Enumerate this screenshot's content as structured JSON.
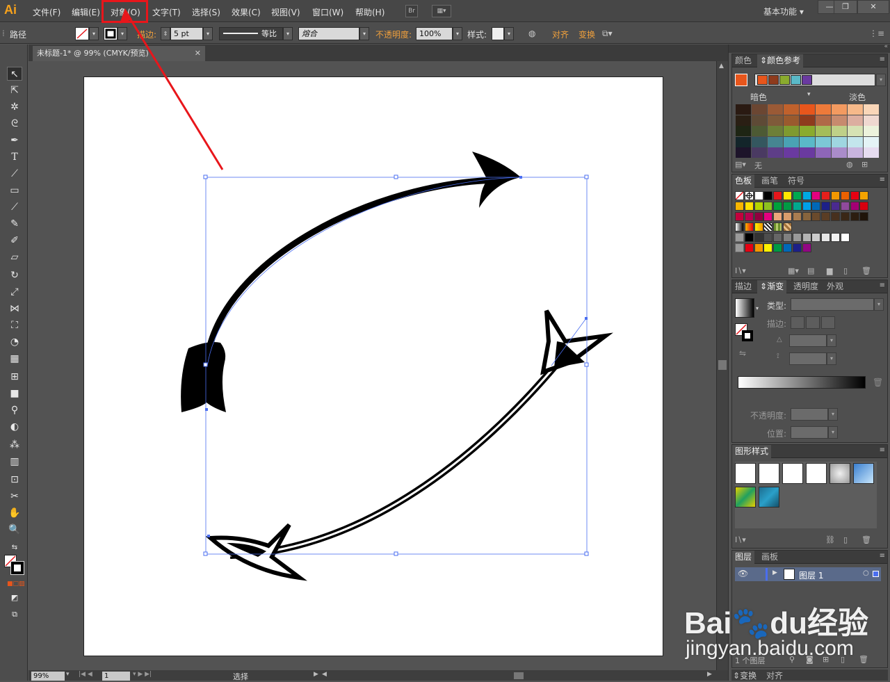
{
  "app": {
    "logo": "Ai"
  },
  "menubar": {
    "items": [
      "文件(F)",
      "编辑(E)",
      "对象(O)",
      "文字(T)",
      "选择(S)",
      "效果(C)",
      "视图(V)",
      "窗口(W)",
      "帮助(H)"
    ],
    "bridge_label": "Br",
    "workspace": "基本功能",
    "workspace_arrow": "▾",
    "window_buttons": [
      "—",
      "❐",
      "✕"
    ],
    "highlighted_item": "对象(O)",
    "annotation_color": "#e8161b"
  },
  "controlbar": {
    "object_type": "路径",
    "stroke_label": "描边:",
    "stroke_weight": "5 pt",
    "profile_label": "等比",
    "brush_label": "熔合",
    "opacity_label": "不透明度:",
    "opacity_value": "100%",
    "style_label": "样式:",
    "align_label": "对齐",
    "transform_label": "变换"
  },
  "document": {
    "tab_title": "未标题-1* @ 99% (CMYK/预览)",
    "tab_close": "✕",
    "zoom": "99%",
    "artboard_number": "1",
    "status_text": "选择"
  },
  "toolbox": {
    "tools": [
      "selection-tool",
      "direct-selection-tool",
      "magic-wand-tool",
      "lasso-tool",
      "pen-tool",
      "type-tool",
      "line-tool",
      "rectangle-tool",
      "paintbrush-tool",
      "pencil-tool",
      "blob-brush-tool",
      "eraser-tool",
      "rotate-tool",
      "scale-tool",
      "width-tool",
      "free-transform-tool",
      "shape-builder-tool",
      "perspective-grid-tool",
      "mesh-tool",
      "gradient-tool",
      "eyedropper-tool",
      "blend-tool",
      "symbol-sprayer-tool",
      "column-graph-tool",
      "artboard-tool",
      "slice-tool",
      "hand-tool",
      "zoom-tool"
    ]
  },
  "panels": {
    "color": {
      "tabs": [
        "颜色",
        "颜色参考"
      ],
      "active_tab": "颜色参考",
      "dark_label": "暗色",
      "light_label": "淡色",
      "none_label": "无",
      "base_color": "#e8561c",
      "harmony_colors": [
        "#e8561c",
        "#8e3b1d",
        "#8aab2e",
        "#5ab9c8",
        "#6a3aa0"
      ],
      "grid_colors": [
        [
          "#2a1a12",
          "#6b4632",
          "#9a5a36",
          "#c0612c",
          "#e8561c",
          "#ee7a3a",
          "#f39a60",
          "#f6b98a",
          "#f9d6b8"
        ],
        [
          "#2a1f14",
          "#5e4a36",
          "#7f5a3a",
          "#9a5a2e",
          "#8e3b1d",
          "#b06a48",
          "#c78a6e",
          "#dcaea0",
          "#efd8d0"
        ],
        [
          "#1e2514",
          "#4d5a34",
          "#6d7f38",
          "#7f9a30",
          "#8aab2e",
          "#a4bd5a",
          "#bfd088",
          "#d6e2b4",
          "#ecf2dc"
        ],
        [
          "#13252a",
          "#34575f",
          "#468591",
          "#4aa3b4",
          "#5ab9c8",
          "#7cc8d6",
          "#9fd6e0",
          "#c3e5ec",
          "#e4f3f6"
        ],
        [
          "#1d142a",
          "#4a3a62",
          "#5e3e88",
          "#6a3aa0",
          "#6a3aa0",
          "#8e66b8",
          "#aa8cca",
          "#c8b4de",
          "#e6dcf0"
        ]
      ]
    },
    "swatches": {
      "tabs": [
        "色板",
        "画笔",
        "符号"
      ],
      "rows": [
        [
          "none",
          "registration",
          "#ffffff",
          "#000000",
          "#e6161b",
          "#ffe600",
          "#00a84f",
          "#00a9e2",
          "#e4007f",
          "#e61f1b",
          "#f39800",
          "#eb6100",
          "#e60012",
          "#f5a300"
        ],
        [
          "#f7b500",
          "#ffe100",
          "#b6d600",
          "#8dc21f",
          "#00a23b",
          "#009a44",
          "#00a98f",
          "#00a0e9",
          "#0068b7",
          "#1d2088",
          "#4a2a8f",
          "#8f4a9c",
          "#a40074",
          "#d7000f"
        ],
        [
          "#c3003d",
          "#b7004f",
          "#91003f",
          "#e4007f",
          "#eda67a",
          "#d99c6b",
          "#a97c50",
          "#87643d",
          "#6a4a2c",
          "#5a3d25",
          "#47301e",
          "#3a2716",
          "#2c1d10",
          "#1f140a"
        ],
        [
          "grad1",
          "grad2",
          "grad3",
          "pattern1",
          "pattern2",
          "pattern3"
        ],
        [
          "folder",
          "#000000",
          "#333333",
          "#4d4d4d",
          "#666666",
          "#808080",
          "#999999",
          "#b3b3b3",
          "#cccccc",
          "#e6e6e6",
          "#f2f2f2",
          "#ffffff"
        ],
        [
          "folder",
          "#e60012",
          "#f39800",
          "#fff100",
          "#009944",
          "#0068b7",
          "#1d2088",
          "#920783"
        ]
      ]
    },
    "gradient": {
      "tabs": [
        "描边",
        "渐变",
        "透明度",
        "外观"
      ],
      "active_tab": "渐变",
      "type_label": "类型:",
      "stroke_label": "描边:",
      "opacity_label": "不透明度:",
      "position_label": "位置:"
    },
    "graphic_styles": {
      "tabs": [
        "图形样式"
      ]
    },
    "layers": {
      "tabs": [
        "图层",
        "画板"
      ],
      "layer_name": "图层 1",
      "footer": "1 个图层"
    },
    "bottom_tabs": [
      "变换",
      "对齐"
    ]
  },
  "watermark": {
    "brand": "Bai🐾du经验",
    "url": "jingyan.baidu.com"
  },
  "colors": {
    "accent_orange": "#f0a03c",
    "selection_blue": "#4a6ef0",
    "logo_orange": "#f7a21b"
  }
}
